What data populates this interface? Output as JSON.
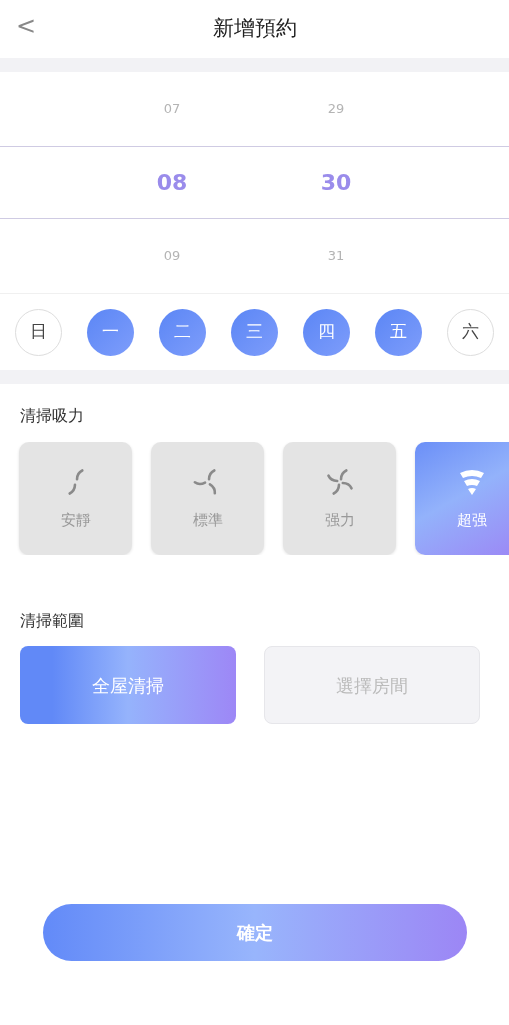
{
  "header": {
    "back": "<",
    "title": "新增預約"
  },
  "time_picker": {
    "columns": [
      {
        "items": [
          {
            "text": "07",
            "selected": false
          },
          {
            "text": "08",
            "selected": true
          },
          {
            "text": "09",
            "selected": false
          }
        ]
      },
      {
        "items": [
          {
            "text": "29",
            "selected": false
          },
          {
            "text": "30",
            "selected": true
          },
          {
            "text": "31",
            "selected": false
          }
        ]
      }
    ]
  },
  "weekdays": [
    {
      "label": "日",
      "selected": false
    },
    {
      "label": "一",
      "selected": true
    },
    {
      "label": "二",
      "selected": true
    },
    {
      "label": "三",
      "selected": true
    },
    {
      "label": "四",
      "selected": true
    },
    {
      "label": "五",
      "selected": true
    },
    {
      "label": "六",
      "selected": false
    }
  ],
  "suction": {
    "title": "清掃吸力",
    "options": [
      {
        "label": "安靜",
        "kind": "fan2",
        "selected": false
      },
      {
        "label": "標準",
        "kind": "fan3",
        "selected": false
      },
      {
        "label": "强力",
        "kind": "fan4",
        "selected": false
      },
      {
        "label": "超强",
        "kind": "tornado",
        "selected": true
      }
    ]
  },
  "scope": {
    "title": "清掃範圍",
    "options": [
      {
        "label": "全屋清掃",
        "selected": true
      },
      {
        "label": "選擇房間",
        "selected": false
      }
    ]
  },
  "confirm": "確定"
}
